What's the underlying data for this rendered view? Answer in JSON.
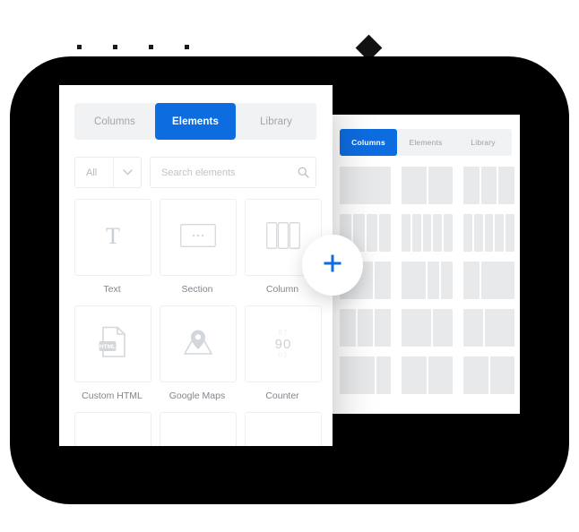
{
  "decor": {
    "dots_count": 4,
    "diamond": "diamond-shape",
    "slab_color": "#000000"
  },
  "colors": {
    "accent_blue": "#0d6ce0",
    "panel_bg": "#ffffff",
    "tabbar_bg": "#f1f2f4",
    "muted_text": "#a0a5ab",
    "placeholder": "#c0c4c8",
    "tile_border": "#efefef",
    "preview_block": "#e7e9eb"
  },
  "front_panel": {
    "tabs": [
      {
        "label": "Columns",
        "active": false
      },
      {
        "label": "Elements",
        "active": true
      },
      {
        "label": "Library",
        "active": false
      }
    ],
    "filter": {
      "selected": "All",
      "chevron_icon": "chevron-down-icon"
    },
    "search": {
      "value": "",
      "placeholder": "Search elements",
      "icon": "search-icon"
    },
    "elements": [
      {
        "label": "Text",
        "icon": "text-t-icon"
      },
      {
        "label": "Section",
        "icon": "section-icon"
      },
      {
        "label": "Column",
        "icon": "column-icon"
      },
      {
        "label": "Custom HTML",
        "icon": "html-file-icon"
      },
      {
        "label": "Google Maps",
        "icon": "map-pin-icon"
      },
      {
        "label": "Counter",
        "icon": "counter-icon"
      }
    ],
    "counter_icon": {
      "above": "87",
      "main": "90",
      "below": "01"
    },
    "partial_row": [
      {
        "icon": "blank-tile-icon"
      },
      {
        "icon": "divider-tile-icon"
      },
      {
        "icon": "blank-tile-icon"
      }
    ]
  },
  "back_panel": {
    "tabs": [
      {
        "label": "Columns",
        "active": true
      },
      {
        "label": "Elements",
        "active": false
      },
      {
        "label": "Library",
        "active": false
      }
    ],
    "layout_presets": [
      {
        "segments": [
          100
        ]
      },
      {
        "segments": [
          50,
          50
        ]
      },
      {
        "segments": [
          33,
          33,
          33
        ]
      },
      {
        "segments": [
          25,
          25,
          25,
          25
        ]
      },
      {
        "segments": [
          20,
          20,
          20,
          20,
          20
        ]
      },
      {
        "segments": [
          20,
          20,
          20,
          20,
          20
        ]
      },
      {
        "segments": [
          66,
          33
        ]
      },
      {
        "segments": [
          50,
          25,
          25
        ]
      },
      {
        "segments": [
          33,
          66
        ]
      },
      {
        "segments": [
          33,
          33,
          33
        ]
      },
      {
        "segments": [
          60,
          40
        ]
      },
      {
        "segments": [
          40,
          60
        ]
      },
      {
        "segments": [
          70,
          30
        ]
      },
      {
        "segments": [
          50,
          50
        ]
      },
      {
        "segments": [
          50,
          50
        ]
      }
    ]
  },
  "plus_button": {
    "icon": "plus-icon",
    "label": "+"
  }
}
